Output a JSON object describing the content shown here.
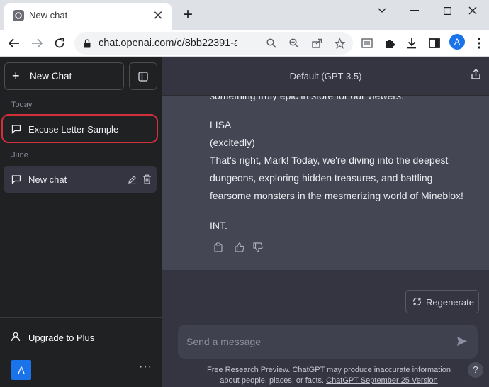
{
  "browser": {
    "tab_title": "New chat",
    "tab_close": "✕",
    "new_tab": "+",
    "url": "chat.openai.com/c/8bb22391-a43e...",
    "profile_initial": "A"
  },
  "sidebar": {
    "new_chat_label": "New Chat",
    "sections": [
      {
        "label": "Today",
        "items": [
          {
            "label": "Excuse Letter Sample"
          }
        ]
      },
      {
        "label": "June",
        "items": [
          {
            "label": "New chat"
          }
        ]
      }
    ],
    "upgrade_label": "Upgrade to Plus",
    "user_initial": "A",
    "more": "···"
  },
  "main": {
    "model_title": "Default (GPT-3.5)",
    "message_lines": [
      "something truly epic in store for our viewers.",
      "LISA",
      "(excitedly)",
      "That's right, Mark! Today, we're diving into the deepest",
      "dungeons, exploring hidden treasures, and battling",
      "fearsome monsters in the mesmerizing world of Mineblox!",
      "INT."
    ],
    "regenerate_label": "Regenerate",
    "input_placeholder": "Send a message",
    "footer_text": "Free Research Preview. ChatGPT may produce inaccurate information about people, places, or facts.",
    "footer_link": "ChatGPT September 25 Version",
    "help_label": "?"
  },
  "colors": {
    "sidebar_bg": "#202123",
    "main_bg": "#343541",
    "message_bg": "#444654",
    "highlight": "#d12f3a"
  }
}
